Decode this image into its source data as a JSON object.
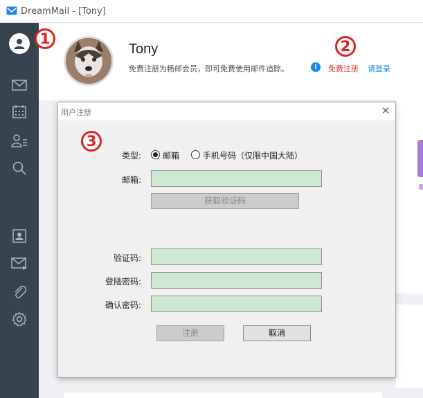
{
  "window": {
    "title": "DreamMail - [Tony]"
  },
  "sidebar": {
    "items": [
      {
        "icon": "account-icon"
      },
      {
        "icon": "mail-icon"
      },
      {
        "icon": "calendar-icon"
      },
      {
        "icon": "contacts-icon"
      },
      {
        "icon": "search-icon"
      },
      {
        "icon": "address-book-icon"
      },
      {
        "icon": "compose-icon"
      },
      {
        "icon": "attachment-icon"
      },
      {
        "icon": "settings-icon"
      }
    ]
  },
  "header": {
    "username": "Tony",
    "promo": "免费注册为畅邮会员，即可免费使用邮件追踪。",
    "info_icon": "!",
    "register_link": "免费注册",
    "login_link": "请登录"
  },
  "annotations": [
    "1",
    "2",
    "3"
  ],
  "dialog": {
    "title": "用户注册",
    "close": "✕",
    "type_label": "类型:",
    "option_email": "邮箱",
    "option_phone": "手机号码（仅限中国大陆）",
    "selected_option": "邮箱",
    "email_label": "邮箱:",
    "email_value": "",
    "get_code_button": "获取验证码",
    "code_label": "验证码:",
    "code_value": "",
    "password_label": "登陆密码:",
    "password_value": "",
    "confirm_label": "确认密码:",
    "confirm_value": "",
    "register_button": "注册",
    "cancel_button": "取消"
  },
  "colors": {
    "sidebar": "#37434f",
    "field_bg": "#cfe8d4",
    "register_link": "#e53935",
    "login_link": "#1e88e5",
    "annotation": "#e02020"
  }
}
